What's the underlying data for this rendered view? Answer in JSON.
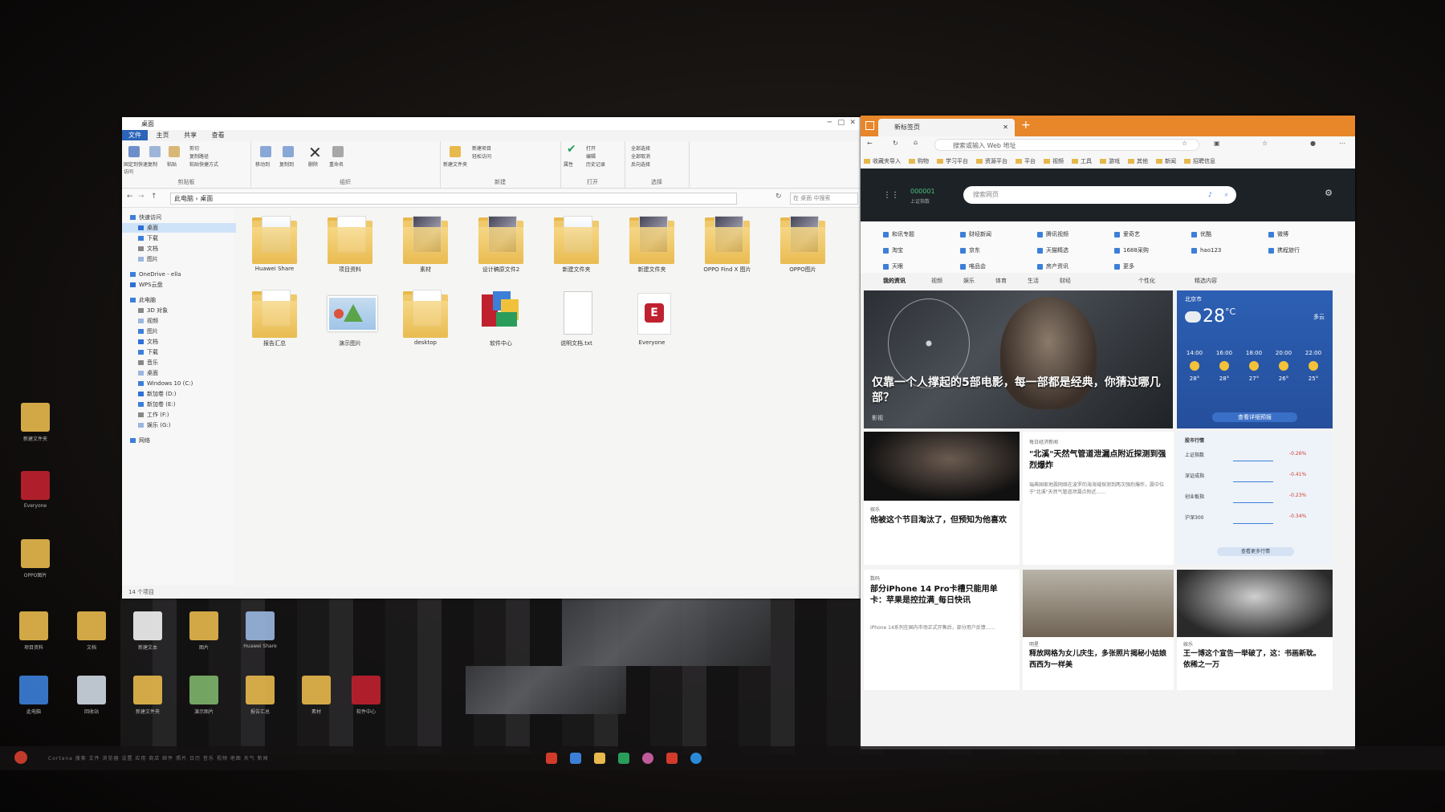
{
  "explorer": {
    "title": "桌面",
    "tabs": [
      "文件",
      "主页",
      "共享",
      "查看"
    ],
    "ribbon_groups": [
      "剪贴板",
      "组织",
      "新建",
      "打开",
      "选择"
    ],
    "ribbon_buttons": {
      "pin": "固定到快速访问",
      "copy": "复制",
      "paste": "粘贴",
      "cut": "剪切",
      "copy_path": "复制路径",
      "paste_shortcut": "粘贴快捷方式",
      "move_to": "移动到",
      "copy_to": "复制到",
      "delete": "删除",
      "rename": "重命名",
      "new_folder": "新建文件夹",
      "new_item": "新建项目",
      "easy_access": "轻松访问",
      "properties": "属性",
      "open": "打开",
      "edit": "编辑",
      "history": "历史记录",
      "select_all": "全部选择",
      "select_none": "全部取消",
      "invert": "反向选择"
    },
    "address": "此电脑 › 桌面",
    "search_placeholder": "在 桌面 中搜索",
    "nav": [
      {
        "label": "快速访问",
        "indent": 0
      },
      {
        "label": "桌面",
        "indent": 1,
        "selected": true
      },
      {
        "label": "下载",
        "indent": 1
      },
      {
        "label": "文档",
        "indent": 1
      },
      {
        "label": "图片",
        "indent": 1
      },
      {
        "label": "OneDrive - ella",
        "indent": 0
      },
      {
        "label": "WPS云盘",
        "indent": 0
      },
      {
        "label": "此电脑",
        "indent": 0
      },
      {
        "label": "3D 对象",
        "indent": 1
      },
      {
        "label": "视频",
        "indent": 1
      },
      {
        "label": "图片",
        "indent": 1
      },
      {
        "label": "文档",
        "indent": 1
      },
      {
        "label": "下载",
        "indent": 1
      },
      {
        "label": "音乐",
        "indent": 1
      },
      {
        "label": "桌面",
        "indent": 1
      },
      {
        "label": "Windows 10 (C:)",
        "indent": 1
      },
      {
        "label": "新加卷 (D:)",
        "indent": 1
      },
      {
        "label": "新加卷 (E:)",
        "indent": 1
      },
      {
        "label": "工作 (F:)",
        "indent": 1
      },
      {
        "label": "娱乐 (G:)",
        "indent": 1
      },
      {
        "label": "网络",
        "indent": 0
      }
    ],
    "files": [
      {
        "label": "Huawei Share",
        "kind": "folder-doc"
      },
      {
        "label": "项目资料",
        "kind": "folder"
      },
      {
        "label": "素材",
        "kind": "folder-img"
      },
      {
        "label": "设计稿原文件2",
        "kind": "folder-img"
      },
      {
        "label": "新建文件夹",
        "kind": "folder-doc"
      },
      {
        "label": "新建文件夹",
        "kind": "folder-img"
      },
      {
        "label": "OPPO Find X 图片",
        "kind": "folder-img"
      },
      {
        "label": "OPPO图片",
        "kind": "folder-img"
      },
      {
        "label": "报告汇总",
        "kind": "folder"
      },
      {
        "label": "演示图片",
        "kind": "image"
      },
      {
        "label": "desktop",
        "kind": "folder"
      },
      {
        "label": "软件中心",
        "kind": "app"
      },
      {
        "label": "说明文档.txt",
        "kind": "doc"
      },
      {
        "label": "Everyone",
        "kind": "app-red"
      }
    ],
    "status": "14 个项目"
  },
  "browser": {
    "tab_title": "新标签页",
    "url_placeholder": "搜索或输入 Web 地址",
    "favorites": [
      "收藏夹导入",
      "购物",
      "学习平台",
      "资源平台",
      "平台",
      "视频",
      "工具",
      "游戏",
      "其他",
      "新闻",
      "招聘信息"
    ],
    "stock_widget": {
      "code": "000001",
      "label": "上证指数"
    },
    "search_placeholder": "搜索网页",
    "quick_links": [
      {
        "label": "和讯专题",
        "color": "#3c7fd9"
      },
      {
        "label": "财经新闻",
        "color": "#3c7fd9"
      },
      {
        "label": "腾讯视频",
        "color": "#2a9d5c"
      },
      {
        "label": "爱奇艺",
        "color": "#2a9d5c"
      },
      {
        "label": "优酷",
        "color": "#e8862a"
      },
      {
        "label": "微博",
        "color": "#d23b2a"
      },
      {
        "label": "淘宝",
        "color": "#e8862a"
      },
      {
        "label": "京东",
        "color": "#d23b2a"
      },
      {
        "label": "天猫精选",
        "color": "#3c7fd9"
      },
      {
        "label": "1688采购",
        "color": "#2a9d5c"
      },
      {
        "label": "hao123",
        "color": "#e8862a"
      },
      {
        "label": "携程旅行",
        "color": "#3c7fd9"
      },
      {
        "label": "天眼",
        "color": "#d23b2a"
      },
      {
        "label": "唯品会",
        "color": "#9b3c9b"
      },
      {
        "label": "房产资讯",
        "color": "#e8862a"
      },
      {
        "label": "更多",
        "color": "#888888"
      }
    ],
    "nav_tabs": [
      "我的资讯",
      "视频",
      "娱乐",
      "体育",
      "生活",
      "财经",
      "个性化",
      "精选内容"
    ],
    "hero": {
      "title": "仅靠一个人撑起的5部电影，每一部都是经典，你猜过哪几部？",
      "source": "影视"
    },
    "weather": {
      "city": "北京市",
      "temp": "28",
      "unit": "°C",
      "range": "多云",
      "hours": [
        {
          "t": "14:00",
          "v": "28°"
        },
        {
          "t": "16:00",
          "v": "28°"
        },
        {
          "t": "18:00",
          "v": "27°"
        },
        {
          "t": "20:00",
          "v": "26°"
        },
        {
          "t": "22:00",
          "v": "25°"
        }
      ],
      "more": "查看详细预报"
    },
    "cards": [
      {
        "title": "他被这个节目淘汰了，但预知为他喜欢",
        "source": "娱乐"
      },
      {
        "title": "\"北溪\"天然气管道泄漏点附近探测到强烈爆炸",
        "source": "每日经济新闻",
        "body": "瑞典国家地震网络在波罗的海海域探测到两次强烈爆炸，震中位于\"北溪\"天然气管道泄漏点附近……"
      },
      {
        "title": "部分iPhone 14 Pro卡槽只能用单卡：苹果是控拉满_每日快讯",
        "source": "数码",
        "body": "iPhone 14系列在国内市场正式开售后，部分用户反馈……"
      },
      {
        "title": "释放网格为女儿庆生，多张照片揭秘小姑娘西西为一样美",
        "source": "明星"
      },
      {
        "title": "王一博这个宣告一举破了，这：书画新耽。依稀之一万",
        "source": "娱乐"
      }
    ],
    "stocks": {
      "title": "股市行情",
      "rows": [
        {
          "name": "上证指数",
          "chg": "-0.26%"
        },
        {
          "name": "深证成指",
          "chg": "-0.41%"
        },
        {
          "name": "创业板指",
          "chg": "-0.23%"
        },
        {
          "name": "沪深300",
          "chg": "-0.34%"
        }
      ],
      "more": "查看更多行情"
    }
  },
  "desktop_icons": [
    "新建文件夹",
    "Everyone",
    "OPPO图片",
    "项目资料",
    "文档",
    "新建文本",
    "图片",
    "Huawei Share",
    "此电脑",
    "回收站",
    "新建文件夹",
    "演示图片",
    "报告汇总",
    "素材",
    "软件中心"
  ],
  "taskbar_label": "Cortana 搜索 文件 浏览器 设置 应用 商店 邮件 照片 日历 音乐 视频 地图 天气 新闻"
}
